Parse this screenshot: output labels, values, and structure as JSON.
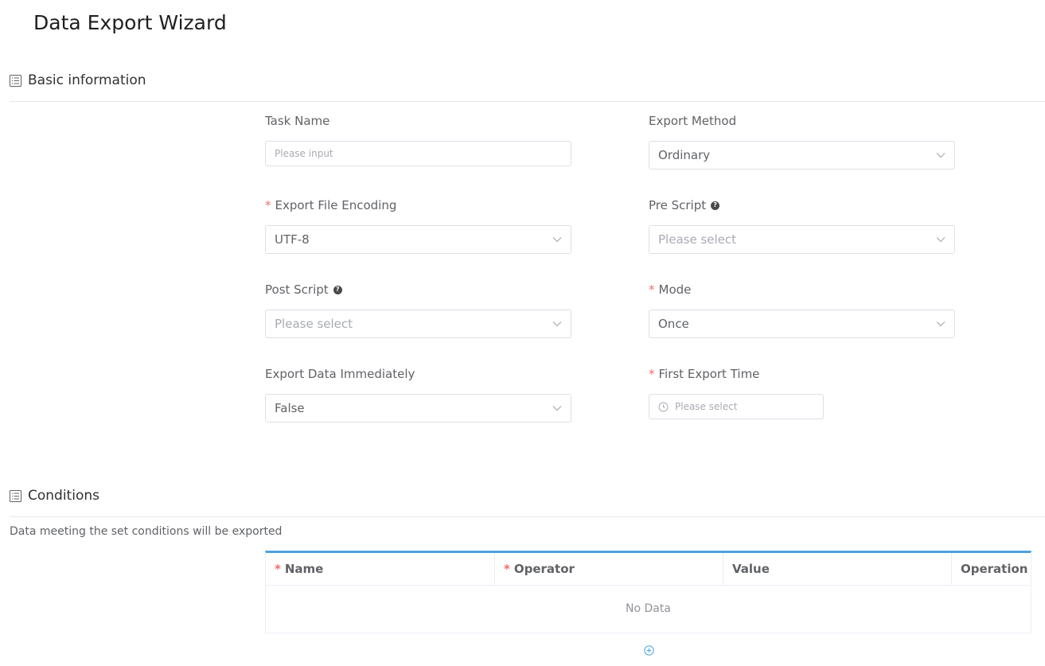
{
  "page": {
    "title": "Data Export Wizard"
  },
  "basic": {
    "title": "Basic information",
    "task_name": {
      "label": "Task Name",
      "placeholder": "Please input",
      "value": ""
    },
    "export_method": {
      "label": "Export Method",
      "value": "Ordinary"
    },
    "export_file_encoding": {
      "label": "Export File Encoding",
      "required": "*",
      "value": "UTF-8"
    },
    "pre_script": {
      "label": "Pre Script",
      "help": "?",
      "placeholder": "Please select"
    },
    "post_script": {
      "label": "Post Script",
      "help": "?",
      "placeholder": "Please select"
    },
    "mode": {
      "label": "Mode",
      "required": "*",
      "value": "Once"
    },
    "export_data_immediately": {
      "label": "Export Data Immediately",
      "value": "False"
    },
    "first_export_time": {
      "label": "First Export Time",
      "required": "*",
      "placeholder": "Please select"
    }
  },
  "conditions": {
    "title": "Conditions",
    "description": "Data meeting the set conditions will be exported",
    "columns": [
      {
        "label": "Name",
        "required": "*"
      },
      {
        "label": "Operator",
        "required": "*"
      },
      {
        "label": "Value",
        "required": ""
      },
      {
        "label": "Operation",
        "required": ""
      }
    ],
    "empty_text": "No Data"
  },
  "colors": {
    "accent": "#4aa3df",
    "required": "#f56c6c",
    "border": "#dcdfe6"
  },
  "icons": {
    "section": "list-icon",
    "select": "chevron-down-icon",
    "help": "question-circle-icon",
    "time": "clock-icon",
    "add": "plus-circle-icon"
  }
}
